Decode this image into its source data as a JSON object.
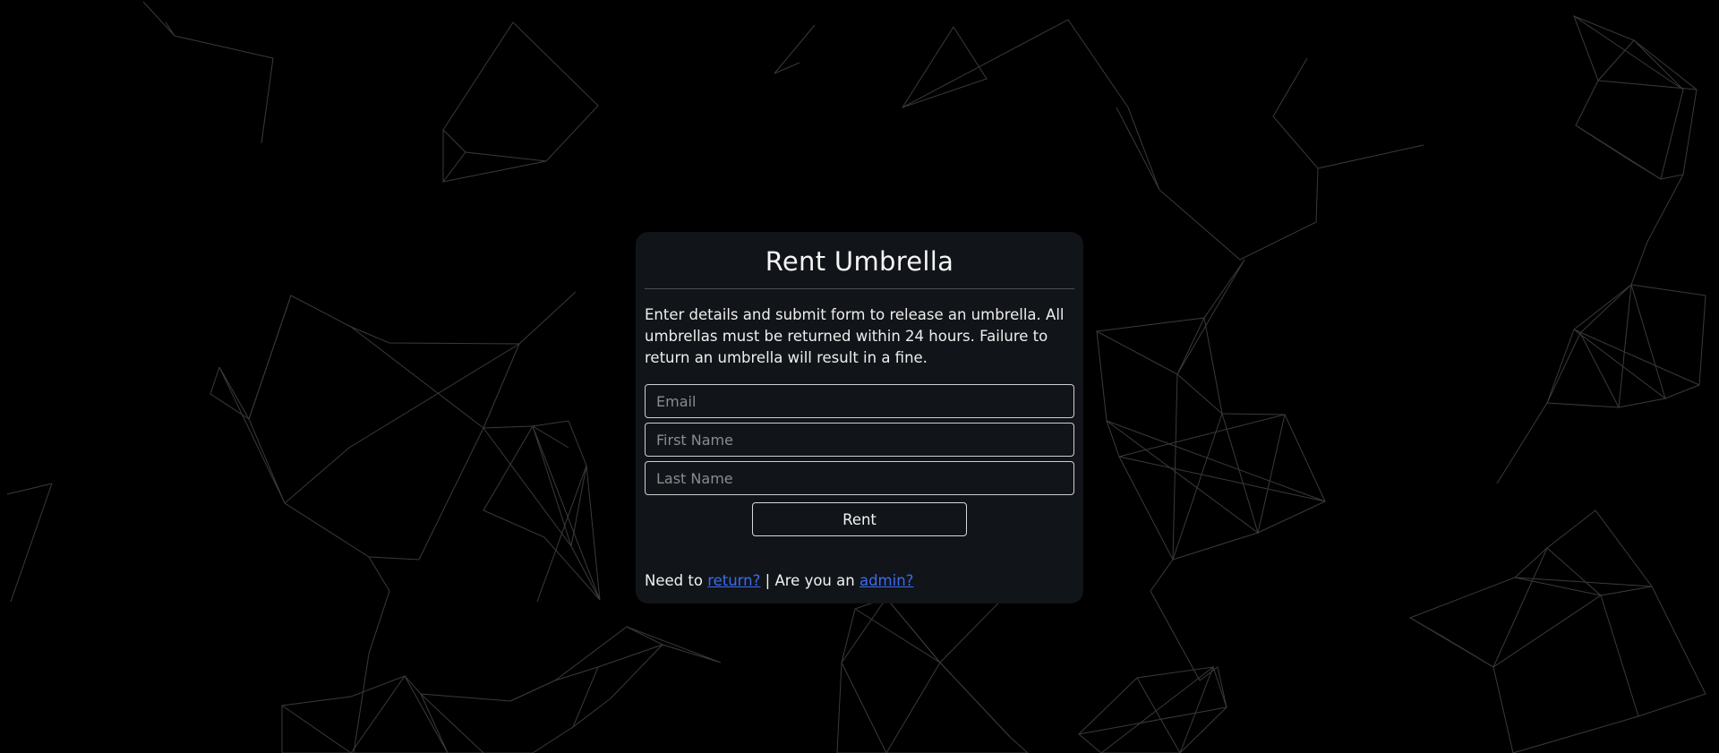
{
  "form": {
    "title": "Rent Umbrella",
    "description": "Enter details and submit form to release an umbrella. All umbrellas must be returned within 24 hours. Failure to return an umbrella will result in a fine.",
    "email_placeholder": "Email",
    "first_name_placeholder": "First Name",
    "last_name_placeholder": "Last Name",
    "submit_label": "Rent"
  },
  "footer": {
    "need_to_text": "Need to",
    "return_link": "return?",
    "separator_text": "| Are you an",
    "admin_link": "admin?"
  },
  "colors": {
    "background": "#000000",
    "card": "#111418",
    "link": "#3b6cf0",
    "network_lines": "#5a5a5a"
  }
}
